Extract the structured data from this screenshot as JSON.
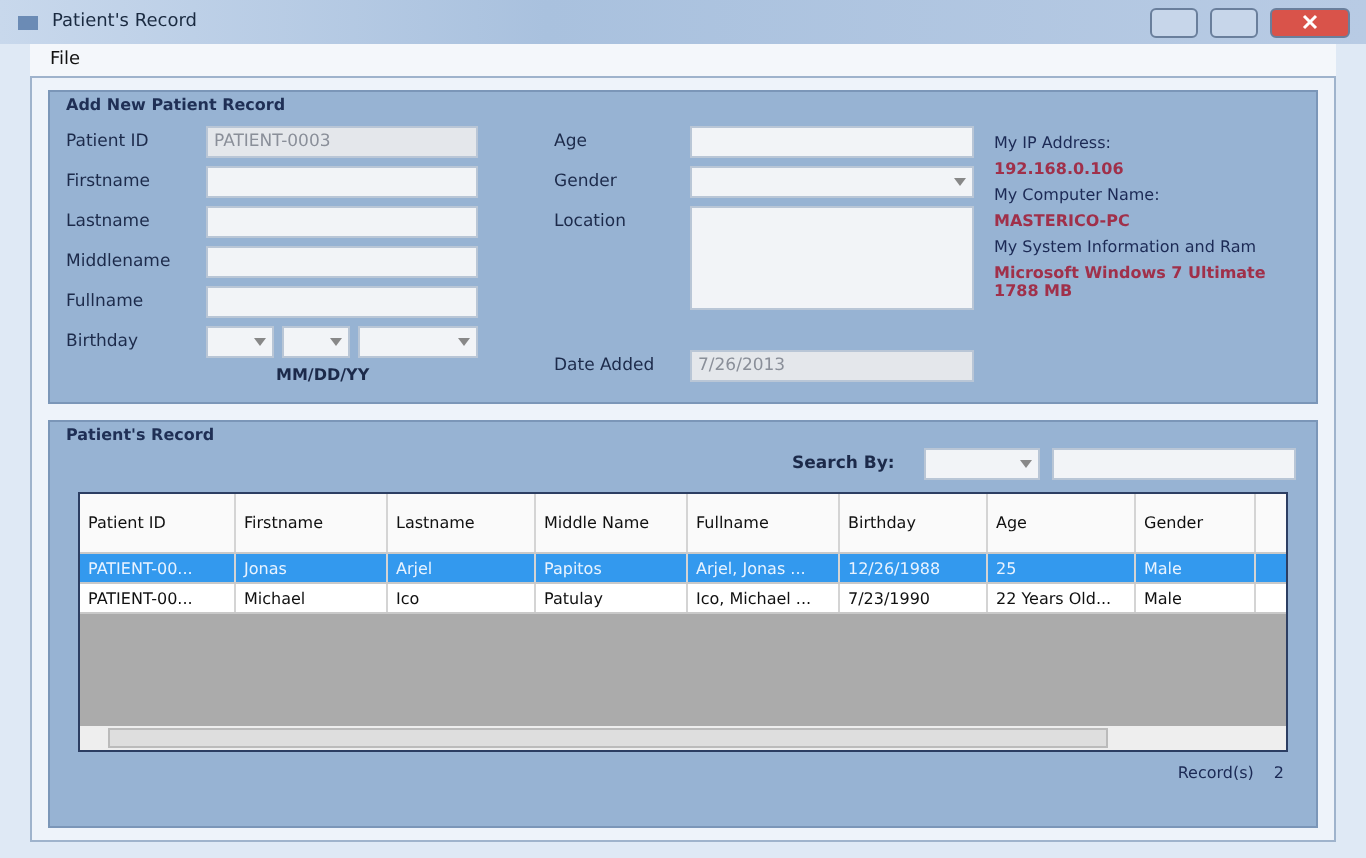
{
  "window": {
    "title": "Patient's Record"
  },
  "menu": [
    "File"
  ],
  "add_group": {
    "title": "Add New Patient Record",
    "left_fields": [
      {
        "label": "Patient ID",
        "kind": "text",
        "value": "PATIENT-0003",
        "disabled": true
      },
      {
        "label": "Firstname",
        "kind": "text",
        "disabled": false
      },
      {
        "label": "Lastname",
        "kind": "text",
        "disabled": false
      },
      {
        "label": "Middlename",
        "kind": "text",
        "disabled": false
      },
      {
        "label": "Fullname",
        "kind": "text",
        "disabled": false
      },
      {
        "label": "Birthday",
        "kind": "date",
        "hint": "MM/DD/YY"
      }
    ],
    "mid_fields": [
      {
        "label": "Age",
        "kind": "text",
        "disabled": false
      },
      {
        "label": "Gender",
        "kind": "combo"
      },
      {
        "label": "Location",
        "kind": "area"
      },
      {
        "label": "Date Added",
        "kind": "text",
        "value": "7/26/2013",
        "disabled": true
      }
    ],
    "info": [
      {
        "kind": "label",
        "text": "My IP Address:"
      },
      {
        "kind": "value",
        "text": "192.168.0.106"
      },
      {
        "kind": "label",
        "text": "My Computer Name:"
      },
      {
        "kind": "value",
        "text": "MASTERICO-PC"
      },
      {
        "kind": "label",
        "text": "My System Information and Ram"
      },
      {
        "kind": "value",
        "text": "Microsoft Windows 7 Ultimate 1788 MB"
      }
    ]
  },
  "records_group": {
    "title": "Patient's Record",
    "search_label": "Search By:",
    "table": {
      "columns": [
        "Patient ID",
        "Firstname",
        "Lastname",
        "Middle Name",
        "Fullname",
        "Birthday",
        "Age",
        "Gender"
      ],
      "rows": [
        {
          "selected": true,
          "cells": [
            "PATIENT-00...",
            "Jonas",
            "Arjel",
            "Papitos",
            "Arjel, Jonas ...",
            "12/26/1988",
            "25",
            "Male"
          ]
        },
        {
          "selected": false,
          "cells": [
            "PATIENT-00...",
            "Michael",
            "Ico",
            "Patulay",
            "Ico, Michael ...",
            "7/23/1990",
            "22 Years Old...",
            "Male"
          ]
        }
      ]
    },
    "count_label": "Record(s)",
    "count": "2"
  }
}
